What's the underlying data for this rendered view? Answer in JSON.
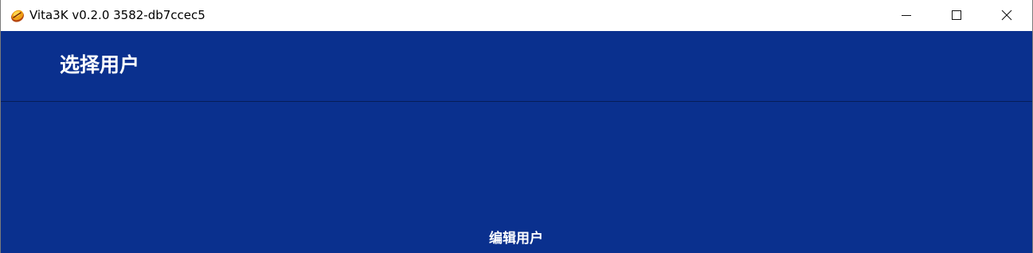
{
  "window": {
    "title": "Vita3K v0.2.0 3582-db7ccec5",
    "app_icon": "vita3k-logo-icon",
    "controls": {
      "minimize_icon": "minimize-icon",
      "maximize_icon": "maximize-icon",
      "close_icon": "close-icon"
    }
  },
  "colors": {
    "background": "#0a308e",
    "header_divider": "#061d57",
    "text": "#ffffff",
    "titlebar": "#ffffff"
  },
  "header": {
    "title": "选择用户"
  },
  "actions": {
    "edit_user_label": "编辑用户"
  }
}
